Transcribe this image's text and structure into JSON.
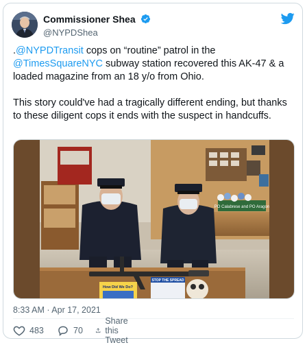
{
  "tweet": {
    "author": {
      "display_name": "Commissioner Shea",
      "handle": "@NYPDShea",
      "verified": true
    },
    "body": {
      "p1_prefix": ".",
      "p1_mention1": "@NYPDTransit",
      "p1_mid": " cops on “routine” patrol in the",
      "p1_mention2": "@TimesSquareNYC",
      "p1_rest": " subway station recovered this AK-47 & a loaded magazine from an 18 y/o from Ohio.",
      "p2": "This story could've had a tragically different ending, but thanks to these diligent cops it ends with the suspect in handcuffs."
    },
    "photo": {
      "sign_text": "PO Calabrese and PO Aragon",
      "poster_left_text": "How Did We Do?",
      "poster_right_text": "STOP THE SPREAD"
    },
    "timestamp": "8:33 AM · Apr 17, 2021",
    "likes": "483",
    "replies": "70",
    "share_label": "Share this Tweet"
  },
  "colors": {
    "link": "#1d9bf0",
    "verified_badge": "#1d9bf0",
    "twitter_bird": "#1d9bf0",
    "like_red": "#f91880"
  },
  "icons": [
    "verified-badge-icon",
    "twitter-bird-icon",
    "heart-icon",
    "reply-icon",
    "share-icon"
  ]
}
